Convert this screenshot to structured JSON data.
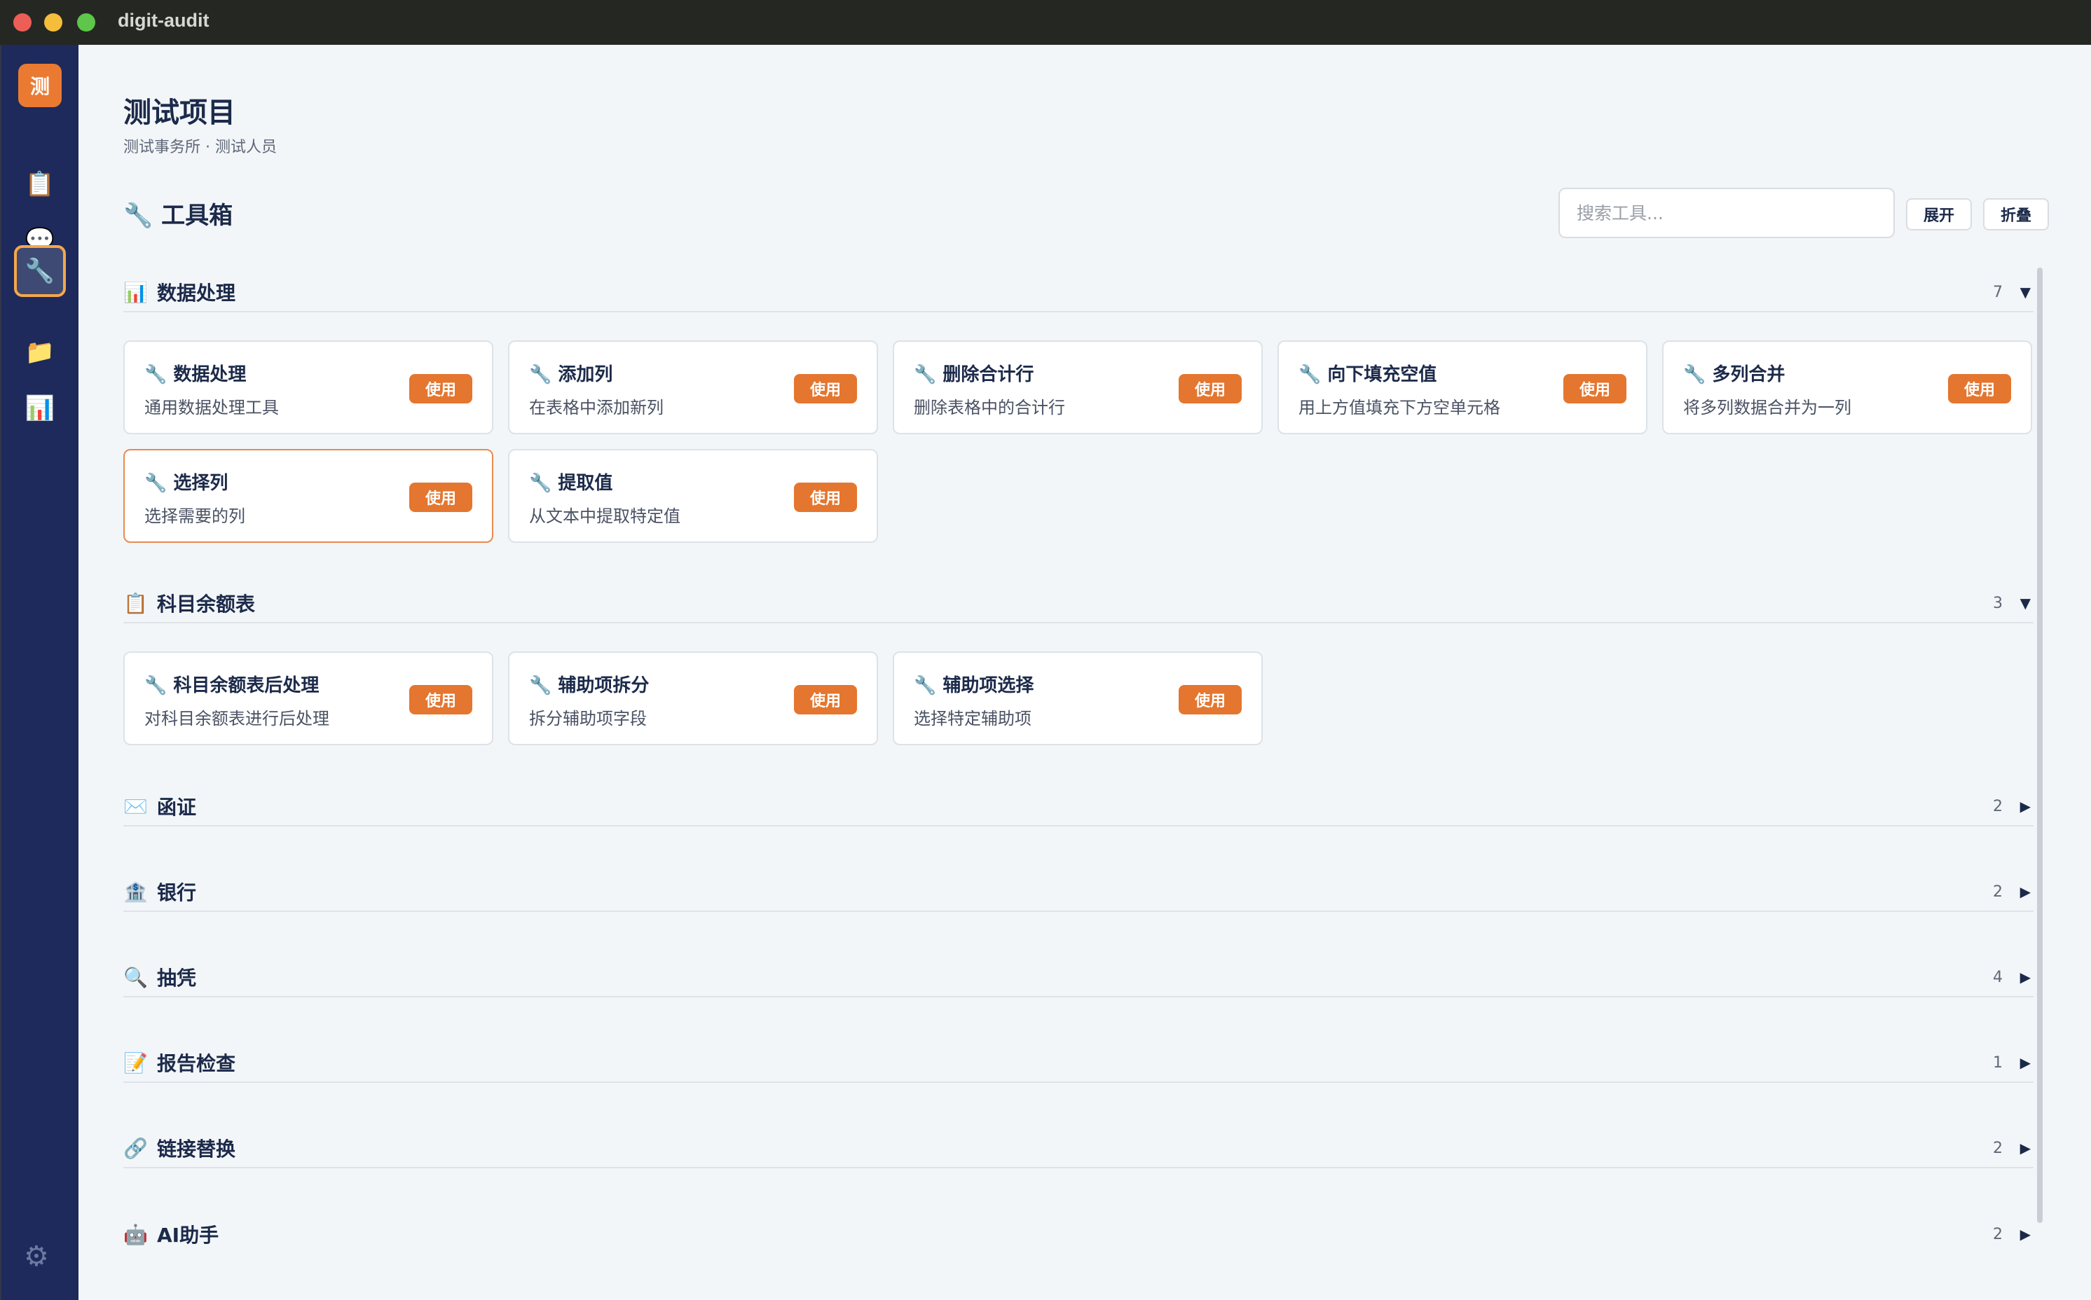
{
  "window": {
    "title": "digit-audit"
  },
  "sidebar": {
    "logo": "测",
    "items": [
      {
        "icon": "clipboard-icon",
        "glyph": "📋"
      },
      {
        "icon": "chat-icon",
        "glyph": "💬"
      },
      {
        "icon": "wrench-icon",
        "glyph": "🔧"
      },
      {
        "icon": "folder-icon",
        "glyph": "📁"
      },
      {
        "icon": "chart-icon",
        "glyph": "📊"
      }
    ],
    "settings_glyph": "⚙"
  },
  "project": {
    "title": "测试项目",
    "subtitle": "测试事务所 · 测试人员"
  },
  "toolbox": {
    "title": "🔧 工具箱",
    "search_placeholder": "搜索工具...",
    "expand_label": "展开",
    "collapse_label": "折叠"
  },
  "use_label": "使用",
  "sections": [
    {
      "icon": "📊",
      "name": "数据处理",
      "count": "7",
      "arrow": "▼",
      "tools": [
        {
          "title": "🔧 数据处理",
          "desc": "通用数据处理工具"
        },
        {
          "title": "🔧 添加列",
          "desc": "在表格中添加新列"
        },
        {
          "title": "🔧 删除合计行",
          "desc": "删除表格中的合计行"
        },
        {
          "title": "🔧 向下填充空值",
          "desc": "用上方值填充下方空单元格"
        },
        {
          "title": "🔧 多列合并",
          "desc": "将多列数据合并为一列"
        },
        {
          "title": "🔧 选择列",
          "desc": "选择需要的列"
        },
        {
          "title": "🔧 提取值",
          "desc": "从文本中提取特定值"
        }
      ]
    },
    {
      "icon": "📋",
      "name": "科目余额表",
      "count": "3",
      "arrow": "▼",
      "tools": [
        {
          "title": "🔧 科目余额表后处理",
          "desc": "对科目余额表进行后处理"
        },
        {
          "title": "🔧 辅助项拆分",
          "desc": "拆分辅助项字段"
        },
        {
          "title": "🔧 辅助项选择",
          "desc": "选择特定辅助项"
        }
      ]
    },
    {
      "icon": "✉️",
      "name": "函证",
      "count": "2",
      "arrow": "▶"
    },
    {
      "icon": "🏦",
      "name": "银行",
      "count": "2",
      "arrow": "▶"
    },
    {
      "icon": "🔍",
      "name": "抽凭",
      "count": "4",
      "arrow": "▶"
    },
    {
      "icon": "📝",
      "name": "报告检查",
      "count": "1",
      "arrow": "▶"
    },
    {
      "icon": "🔗",
      "name": "链接替换",
      "count": "2",
      "arrow": "▶"
    },
    {
      "icon": "🤖",
      "name": "AI助手",
      "count": "2",
      "arrow": "▶"
    }
  ]
}
